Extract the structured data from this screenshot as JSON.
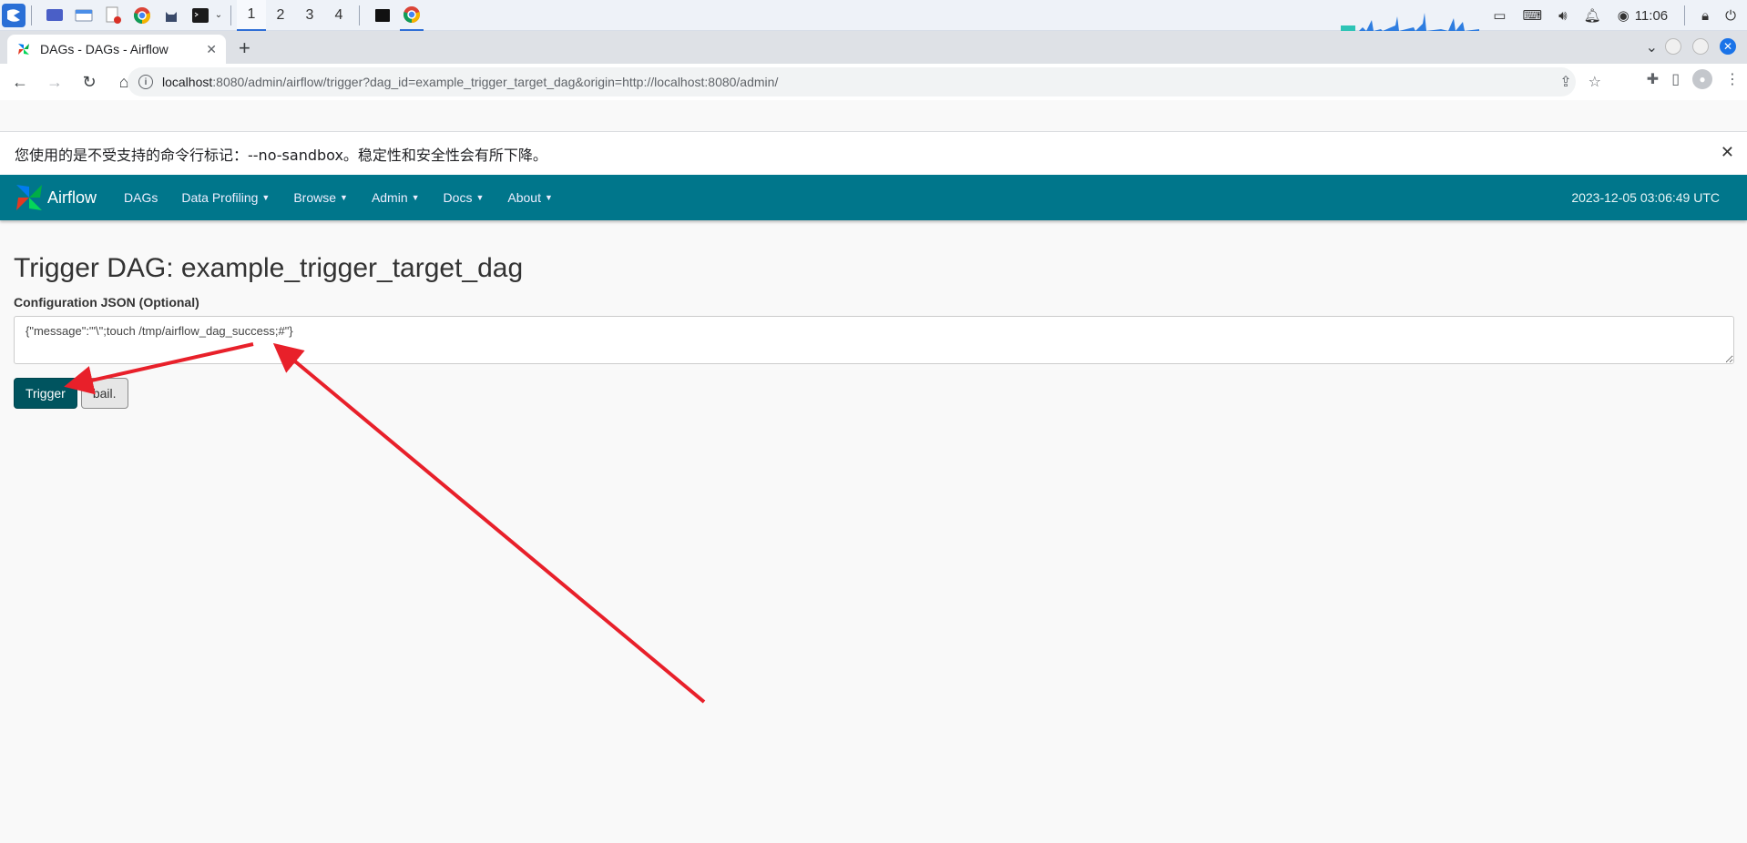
{
  "taskbar": {
    "workspaces": [
      "1",
      "2",
      "3",
      "4"
    ],
    "active_workspace": "1",
    "time": "11:06"
  },
  "browser": {
    "tab_title": "DAGs - DAGs - Airflow",
    "url_host": "localhost",
    "url_rest": ":8080/admin/airflow/trigger?dag_id=example_trigger_target_dag&origin=http://localhost:8080/admin/",
    "infobar_message": "您使用的是不受支持的命令行标记：--no-sandbox。稳定性和安全性会有所下降。",
    "accent_color": "#1a73e8"
  },
  "airflow_nav": {
    "brand": "Airflow",
    "items": [
      "DAGs",
      "Data Profiling",
      "Browse",
      "Admin",
      "Docs",
      "About"
    ],
    "datetime": "2023-12-05 03:06:49 UTC",
    "nav_color": "#00768b"
  },
  "main": {
    "title": "Trigger DAG: example_trigger_target_dag",
    "config_label": "Configuration JSON (Optional)",
    "config_value": "{\"message\":\"'\\\";touch /tmp/airflow_dag_success;#\"}",
    "trigger_button": "Trigger",
    "bail_button": "bail."
  },
  "annotation": {
    "arrow_color": "#e8202a"
  }
}
